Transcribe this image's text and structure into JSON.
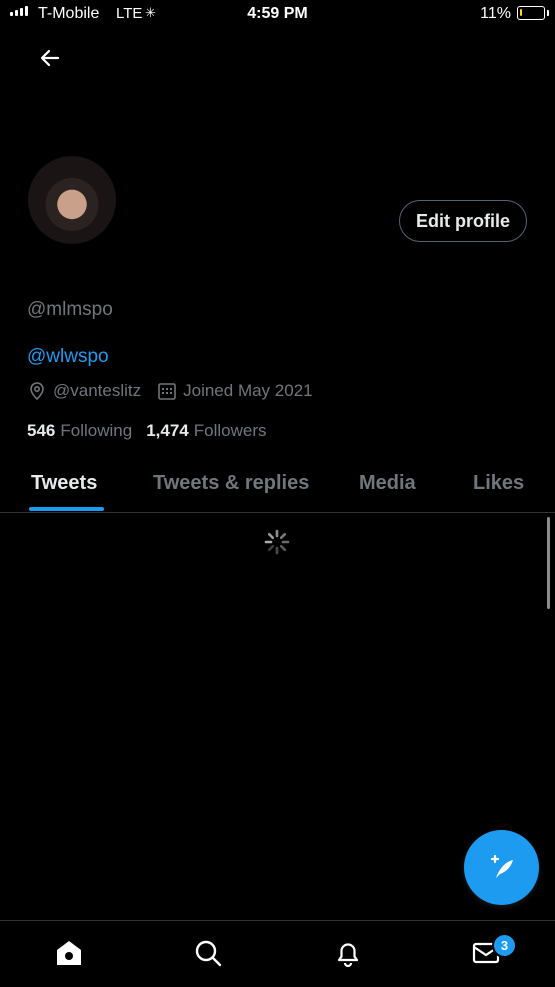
{
  "status_bar": {
    "carrier": "T-Mobile",
    "network": "LTE",
    "time": "4:59 PM",
    "battery": "11%",
    "battery_level": 0.11
  },
  "header": {
    "back_icon": "arrow-left-icon"
  },
  "profile": {
    "handle": "@mlmspo",
    "bio_link": "@wlwspo",
    "location": "@vanteslitz",
    "joined": "Joined May 2021",
    "following_count": "546",
    "following_label": "Following",
    "followers_count": "1,474",
    "followers_label": "Followers",
    "edit_button": "Edit profile"
  },
  "tabs": [
    {
      "label": "Tweets",
      "active": true
    },
    {
      "label": "Tweets & replies",
      "active": false
    },
    {
      "label": "Media",
      "active": false
    },
    {
      "label": "Likes",
      "active": false
    }
  ],
  "bottom_nav": {
    "items": [
      "home-icon",
      "search-icon",
      "notifications-icon",
      "messages-icon"
    ],
    "messages_badge": "3"
  },
  "colors": {
    "accent": "#1d9bf0",
    "background": "#000000",
    "muted": "#71767b"
  }
}
